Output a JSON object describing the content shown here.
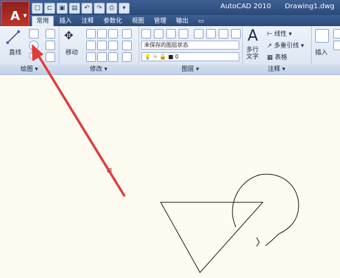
{
  "window": {
    "app_name": "AutoCAD 2010",
    "doc_name": "Drawing1.dwg"
  },
  "app_button": {
    "logo": "A"
  },
  "tabs": [
    "常用",
    "插入",
    "注释",
    "参数化",
    "视图",
    "管理",
    "输出"
  ],
  "panels": {
    "draw": {
      "label": "绘图",
      "line_label": "直线"
    },
    "modify": {
      "label": "修改",
      "move_label": "移动"
    },
    "layers": {
      "label": "图层",
      "layer_state": "未保存的图层状态",
      "current_layer": "0"
    },
    "annotation": {
      "label": "注释",
      "mtext_label": "多行文字",
      "linear_label": "线性",
      "multileader_label": "多重引线",
      "table_label": "表格"
    },
    "insert": {
      "label": "插入"
    }
  },
  "colors": {
    "title_bar": "#2b4a7b",
    "highlight_red": "#e23b3b",
    "canvas_bg": "#fefcf0"
  }
}
